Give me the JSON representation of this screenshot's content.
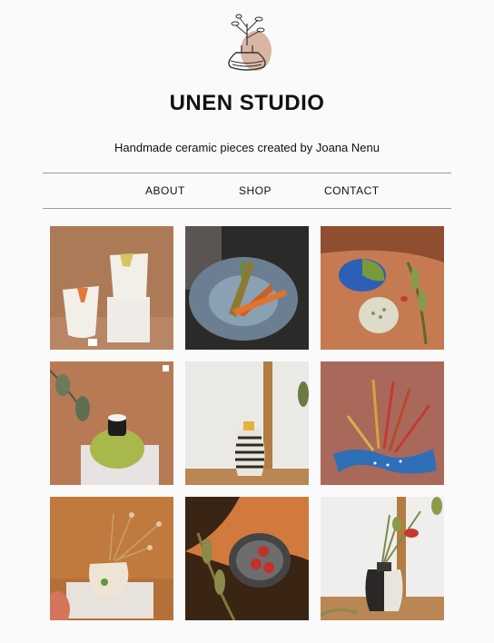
{
  "site": {
    "title": "UNEN STUDIO",
    "subtitle": "Handmade ceramic pieces created by Joana Nenu"
  },
  "nav": {
    "items": [
      {
        "label": "ABOUT"
      },
      {
        "label": "SHOP"
      },
      {
        "label": "CONTACT"
      }
    ]
  },
  "colors": {
    "background": "#fafafa",
    "rule": "#9a9a9a",
    "logo_accent": "#d9b6a3",
    "terracotta": "#a5623c",
    "cobalt": "#2f6fb8"
  },
  "gallery": {
    "tiles": [
      {
        "icon": "two-white-cups-photo"
      },
      {
        "icon": "grilled-vegetables-plate-photo"
      },
      {
        "icon": "blue-and-white-dishes-photo"
      },
      {
        "icon": "green-vase-photo"
      },
      {
        "icon": "striped-vase-photo"
      },
      {
        "icon": "brushes-holder-photo"
      },
      {
        "icon": "dried-flowers-vase-photo"
      },
      {
        "icon": "strawberry-bowl-photo"
      },
      {
        "icon": "black-white-vase-photo"
      }
    ]
  }
}
